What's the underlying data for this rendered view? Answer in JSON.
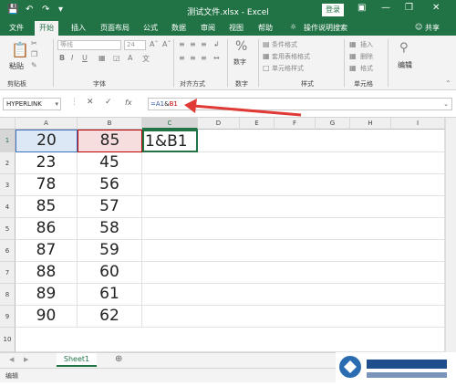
{
  "titlebar": {
    "title": "测试文件.xlsx  -  Excel",
    "signin": "登录",
    "save_icon": "save-icon",
    "undo_icon": "undo-icon",
    "redo_icon": "redo-icon"
  },
  "tabs": [
    "文件",
    "开始",
    "插入",
    "页面布局",
    "公式",
    "数据",
    "审阅",
    "视图",
    "帮助"
  ],
  "tell_me": "操作说明搜索",
  "share": "共享",
  "ribbon": {
    "paste": "粘贴",
    "font_name": "等线",
    "font_size": "24",
    "group_clipboard": "剪贴板",
    "group_font": "字体",
    "group_align": "对齐方式",
    "number_label": "数字",
    "group_number": "数字",
    "cond_format": "条件格式",
    "table_format": "套用表格格式",
    "cell_style": "单元格样式",
    "group_styles": "样式",
    "insert": "插入",
    "delete": "删除",
    "format": "格式",
    "group_cells": "单元格",
    "edit": "编辑"
  },
  "formula_bar": {
    "name_box": "HYPERLINK",
    "formula_a": "=A1",
    "formula_amp": "&",
    "formula_b": "B1",
    "cancel": "✕",
    "enter": "✓",
    "fx": "fx"
  },
  "columns": [
    "A",
    "B",
    "C",
    "D",
    "E",
    "F",
    "G",
    "H",
    "I"
  ],
  "rows": [
    {
      "n": "1",
      "a": "20",
      "b": "85",
      "c": "1&B1"
    },
    {
      "n": "2",
      "a": "23",
      "b": "45",
      "c": ""
    },
    {
      "n": "3",
      "a": "78",
      "b": "56",
      "c": ""
    },
    {
      "n": "4",
      "a": "85",
      "b": "57",
      "c": ""
    },
    {
      "n": "5",
      "a": "86",
      "b": "58",
      "c": ""
    },
    {
      "n": "6",
      "a": "87",
      "b": "59",
      "c": ""
    },
    {
      "n": "7",
      "a": "88",
      "b": "60",
      "c": ""
    },
    {
      "n": "8",
      "a": "89",
      "b": "61",
      "c": ""
    },
    {
      "n": "9",
      "a": "90",
      "b": "62",
      "c": ""
    },
    {
      "n": "10",
      "a": "",
      "b": "",
      "c": ""
    }
  ],
  "sheet_tab": "Sheet1",
  "status": "编辑",
  "colors": {
    "excel_green": "#217346",
    "ref_blue": "#2f5597",
    "ref_red": "#c00000",
    "arrow": "#e03a36"
  }
}
